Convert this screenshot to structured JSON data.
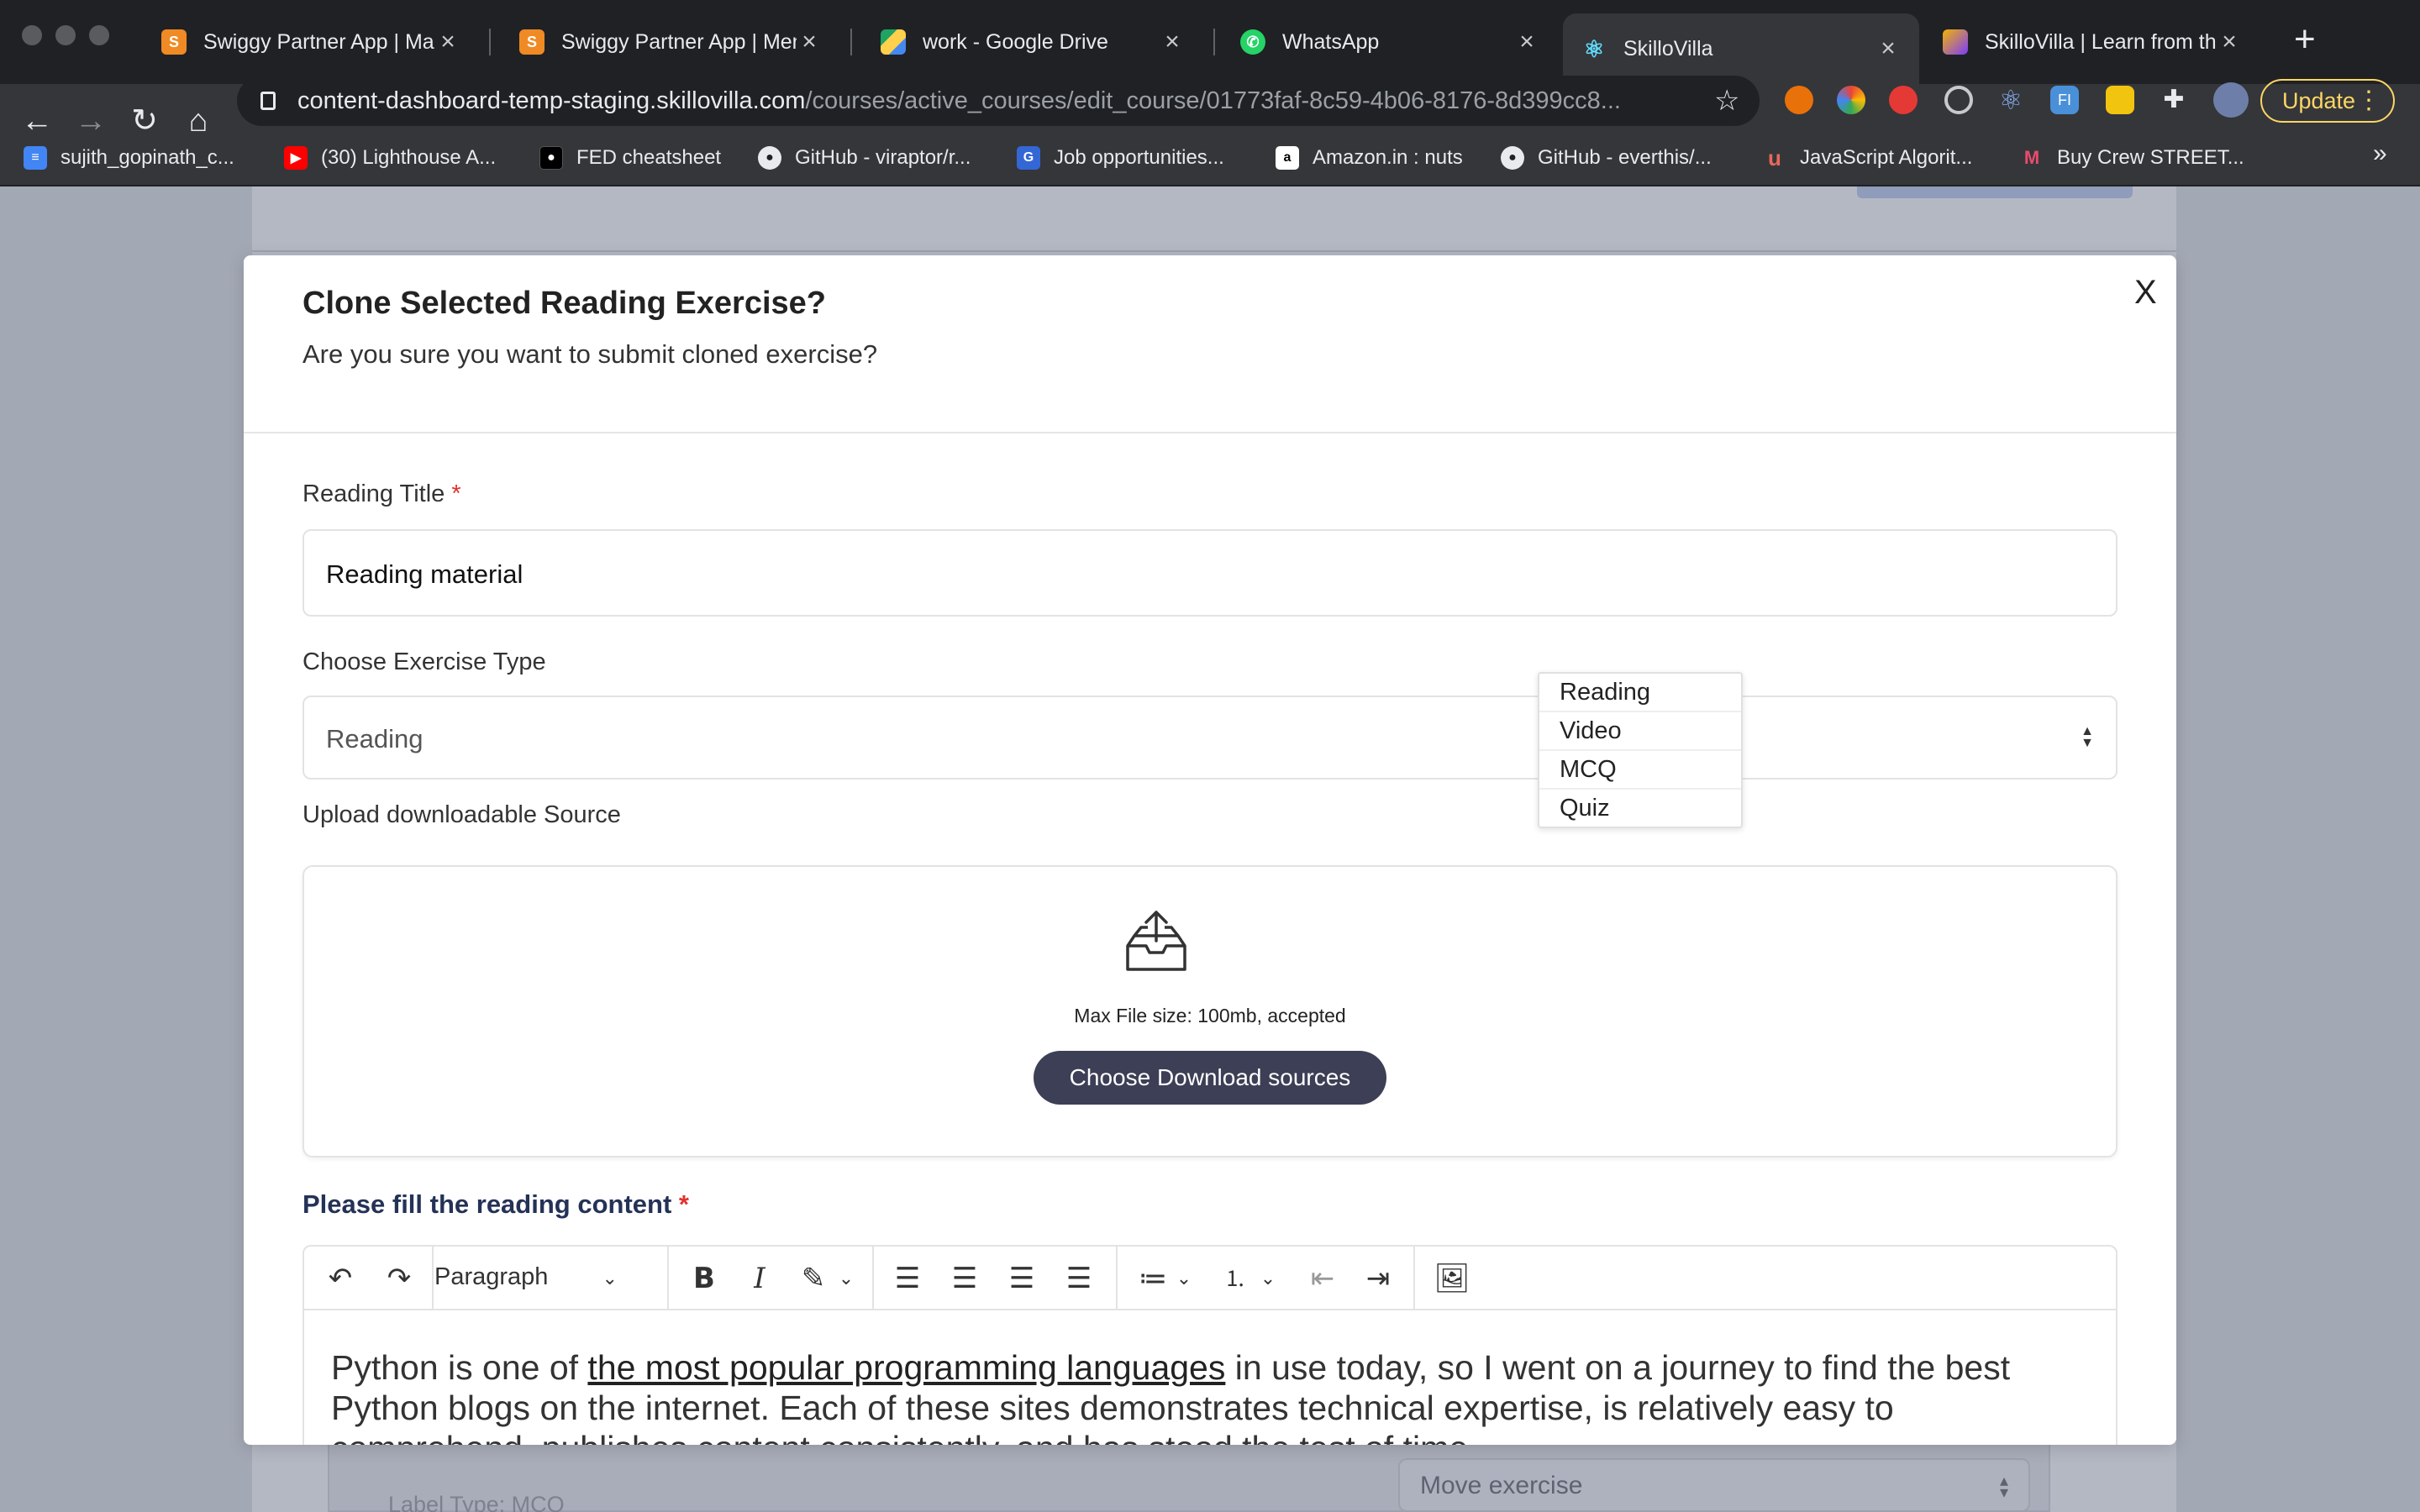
{
  "browser": {
    "tabs": [
      {
        "title": "Swiggy Partner App | Man",
        "favicon": "swiggy-icon"
      },
      {
        "title": "Swiggy Partner App | Men",
        "favicon": "swiggy-icon"
      },
      {
        "title": "work - Google Drive",
        "favicon": "google-drive-icon"
      },
      {
        "title": "WhatsApp",
        "favicon": "whatsapp-icon"
      },
      {
        "title": "SkilloVilla",
        "favicon": "react-icon"
      },
      {
        "title": "SkilloVilla | Learn from the",
        "favicon": "skillovilla-icon"
      }
    ],
    "url_host": "content-dashboard-temp-staging.skillovilla.com",
    "url_path": "/courses/active_courses/edit_course/01773faf-8c59-4b06-8176-8d399cc8...",
    "update_label": "Update",
    "bookmarks": [
      "sujith_gopinath_c...",
      "(30) Lighthouse A...",
      "FED cheatsheet",
      "GitHub - viraptor/r...",
      "Job opportunities...",
      "Amazon.in : nuts",
      "GitHub - everthis/...",
      "JavaScript Algorit...",
      "Buy Crew STREET..."
    ]
  },
  "background_page": {
    "label_type": "Label Type: MCQ",
    "move_select": "Move exercise"
  },
  "modal": {
    "title": "Clone Selected Reading Exercise?",
    "subtitle": "Are you sure you want to submit cloned exercise?",
    "close_label": "X",
    "reading_title_label": "Reading Title",
    "required_mark": "*",
    "reading_title_value": "Reading material",
    "exercise_type_label": "Choose Exercise Type",
    "exercise_type_value": "Reading",
    "exercise_type_options": [
      "Reading",
      "Video",
      "MCQ",
      "Quiz"
    ],
    "upload_label": "Upload downloadable Source",
    "upload_hint": "Max File size: 100mb, accepted",
    "upload_button": "Choose Download sources",
    "content_label": "Please fill the reading content",
    "editor": {
      "block_style": "Paragraph",
      "text_before_link": "Python is one of ",
      "link_text": "the most popular programming languages",
      "text_after_link": " in use today, so I went on a journey to find the best Python blogs on the internet. Each of these sites demonstrates technical expertise, is relatively easy to comprehend, publishes content consistently, and has stood the test of time."
    }
  },
  "colors": {
    "accent_dark": "#3c3f55",
    "content_label": "#243257",
    "required": "#e03131",
    "update": "#fdd663"
  }
}
